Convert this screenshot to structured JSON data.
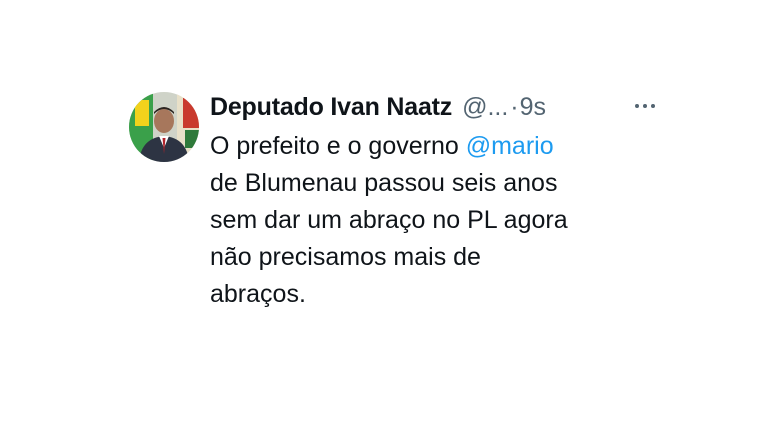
{
  "tweet": {
    "author": {
      "display_name": "Deputado Ivan Naatz",
      "handle": "@...",
      "avatar_icon": "profile-photo"
    },
    "separator": "·",
    "timestamp": "9s",
    "more_icon": "more-horizontal-icon",
    "text": {
      "line1_prefix": "O prefeito e o governo ",
      "line1_mention": "@mario",
      "line2": "de Blumenau passou seis anos",
      "line3": "sem dar um abraço no PL agora",
      "line4": "não precisamos mais de",
      "line5": "abraços."
    },
    "colors": {
      "text": "#0f1419",
      "secondary": "#536471",
      "mention": "#1d9bf0"
    }
  }
}
